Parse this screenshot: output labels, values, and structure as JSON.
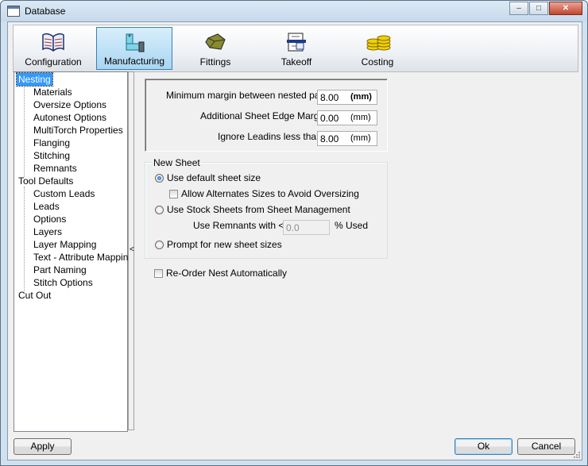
{
  "window": {
    "title": "Database"
  },
  "window_controls": {
    "minimize": "–",
    "maximize": "□",
    "close": "✕"
  },
  "toolbar": {
    "items": [
      {
        "label": "Configuration",
        "icon": "book-icon"
      },
      {
        "label": "Manufacturing",
        "icon": "pipe-fitting-icon",
        "active": true
      },
      {
        "label": "Fittings",
        "icon": "fittings-icon"
      },
      {
        "label": "Takeoff",
        "icon": "takeoff-icon"
      },
      {
        "label": "Costing",
        "icon": "coins-icon"
      }
    ]
  },
  "tree": {
    "items": [
      {
        "label": "Nesting",
        "level": 0,
        "selected": true
      },
      {
        "label": "Materials",
        "level": 1
      },
      {
        "label": "Oversize Options",
        "level": 1
      },
      {
        "label": "Autonest Options",
        "level": 1
      },
      {
        "label": "MultiTorch Properties",
        "level": 1
      },
      {
        "label": "Flanging",
        "level": 1
      },
      {
        "label": "Stitching",
        "level": 1
      },
      {
        "label": "Remnants",
        "level": 1
      },
      {
        "label": "Tool Defaults",
        "level": 0
      },
      {
        "label": "Custom Leads",
        "level": 1
      },
      {
        "label": "Leads",
        "level": 1
      },
      {
        "label": "Options",
        "level": 1
      },
      {
        "label": "Layers",
        "level": 1
      },
      {
        "label": "Layer Mapping",
        "level": 1
      },
      {
        "label": "Text - Attribute Mapping",
        "level": 1
      },
      {
        "label": "Part Naming",
        "level": 1
      },
      {
        "label": "Stitch Options",
        "level": 1
      },
      {
        "label": "Cut Out",
        "level": 0
      }
    ]
  },
  "splitter": {
    "glyph": "<"
  },
  "margins": {
    "min_margin": {
      "label": "Minimum margin between nested parts:",
      "value": "8.00",
      "unit": "(mm)"
    },
    "edge_margin": {
      "label": "Additional Sheet Edge Margin",
      "value": "0.00",
      "unit": "(mm)"
    },
    "ignore_leadins": {
      "label": "Ignore Leadins less than:",
      "value": "8.00",
      "unit": "(mm)"
    }
  },
  "new_sheet": {
    "title": "New Sheet",
    "use_default": "Use default sheet size",
    "allow_alternates": "Allow Alternates Sizes to Avoid Oversizing",
    "use_stock": "Use Stock Sheets from Sheet Management",
    "remnants_label": "Use Remnants with <=",
    "remnants_value": "0.0",
    "remnants_unit": "% Used",
    "prompt": "Prompt for new sheet sizes"
  },
  "reorder": "Re-Order Nest Automatically",
  "buttons": {
    "apply": "Apply",
    "ok": "Ok",
    "cancel": "Cancel"
  },
  "colors": {
    "selection": "#3399ff",
    "active_tool": "#a9d6f2"
  }
}
